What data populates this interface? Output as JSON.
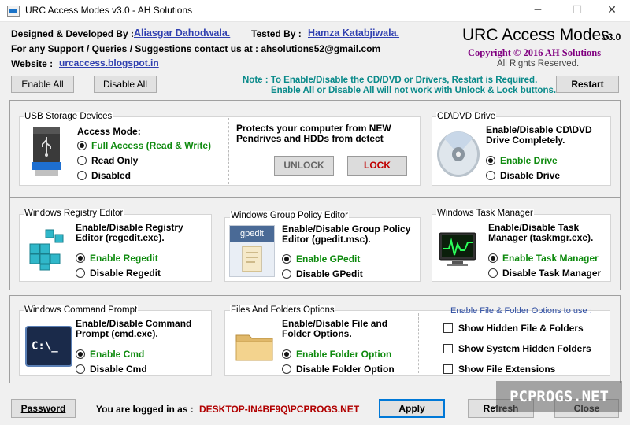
{
  "window": {
    "title": "URC Access Modes v3.0 - AH Solutions",
    "minimize_glyph": "─",
    "maximize_glyph": "☐",
    "close_glyph": "✕"
  },
  "header": {
    "designed_label": "Designed & Developed By :",
    "designer_name": "Aliasgar Dahodwala.",
    "tested_label": "Tested By :",
    "tester_name": "Hamza Katabjiwala.",
    "support_text": "For any Support / Queries / Suggestions contact us at : ahsolutions52@gmail.com",
    "website_label": "Website :",
    "website_url": "urcaccess.blogspot.in",
    "app_name": "URC Access Modes",
    "app_version": "v3.0",
    "copyright": "Copyright © 2016 AH Solutions",
    "rights": "All Rights Reserved.",
    "enable_all": "Enable All",
    "disable_all": "Disable All",
    "note_line1": "Note : To Enable/Disable the CD/DVD or Drivers, Restart is Required.",
    "note_line2": "Enable All or Disable All will not work with Unlock & Lock buttons.",
    "restart": "Restart"
  },
  "usb": {
    "group_label": "USB Storage Devices",
    "mode_label": "Access Mode:",
    "options": [
      "Full Access (Read & Write)",
      "Read Only",
      "Disabled"
    ],
    "selected": 0,
    "protect_text": "Protects your computer from NEW Pendrives and HDDs from detect",
    "unlock": "UNLOCK",
    "lock": "LOCK"
  },
  "cd": {
    "group_label": "CD\\DVD Drive",
    "desc": "Enable/Disable CD\\DVD Drive Completely.",
    "options": [
      "Enable Drive",
      "Disable Drive"
    ],
    "selected": 0
  },
  "registry": {
    "group_label": "Windows Registry Editor",
    "desc": "Enable/Disable Registry Editor (regedit.exe).",
    "options": [
      "Enable Regedit",
      "Disable Regedit"
    ],
    "selected": 0
  },
  "gpedit": {
    "group_label": "Windows Group Policy Editor",
    "icon_text": "gpedit",
    "desc": "Enable/Disable Group Policy Editor (gpedit.msc).",
    "options": [
      "Enable GPedit",
      "Disable GPedit"
    ],
    "selected": 0
  },
  "taskmgr": {
    "group_label": "Windows Task Manager",
    "desc": "Enable/Disable Task Manager (taskmgr.exe).",
    "options": [
      "Enable Task Manager",
      "Disable Task Manager"
    ],
    "selected": 0
  },
  "cmd": {
    "group_label": "Windows Command Prompt",
    "icon_text": "C:\\_",
    "desc": "Enable/Disable Command Prompt (cmd.exe).",
    "options": [
      "Enable Cmd",
      "Disable Cmd"
    ],
    "selected": 0
  },
  "folders": {
    "group_label": "Files And Folders Options",
    "desc": "Enable/Disable File and Folder Options.",
    "options": [
      "Enable Folder Option",
      "Disable Folder Option"
    ],
    "selected": 0,
    "checks_heading": "Enable File & Folder Options to use :",
    "checks": [
      "Show Hidden File & Folders",
      "Show System Hidden Folders",
      "Show File Extensions"
    ]
  },
  "footer": {
    "password": "Password",
    "logged_label": "You are logged in as :",
    "user": "DESKTOP-IN4BF9Q\\PCPROGS.NET",
    "apply": "Apply",
    "refresh": "Refresh",
    "close": "Close"
  },
  "watermark": "PCPROGS.NET",
  "colors": {
    "selected_option": "#0e8a0e",
    "note": "#0a8a8a",
    "copyright": "#800080",
    "user": "#b00000",
    "link": "#3040b0"
  }
}
